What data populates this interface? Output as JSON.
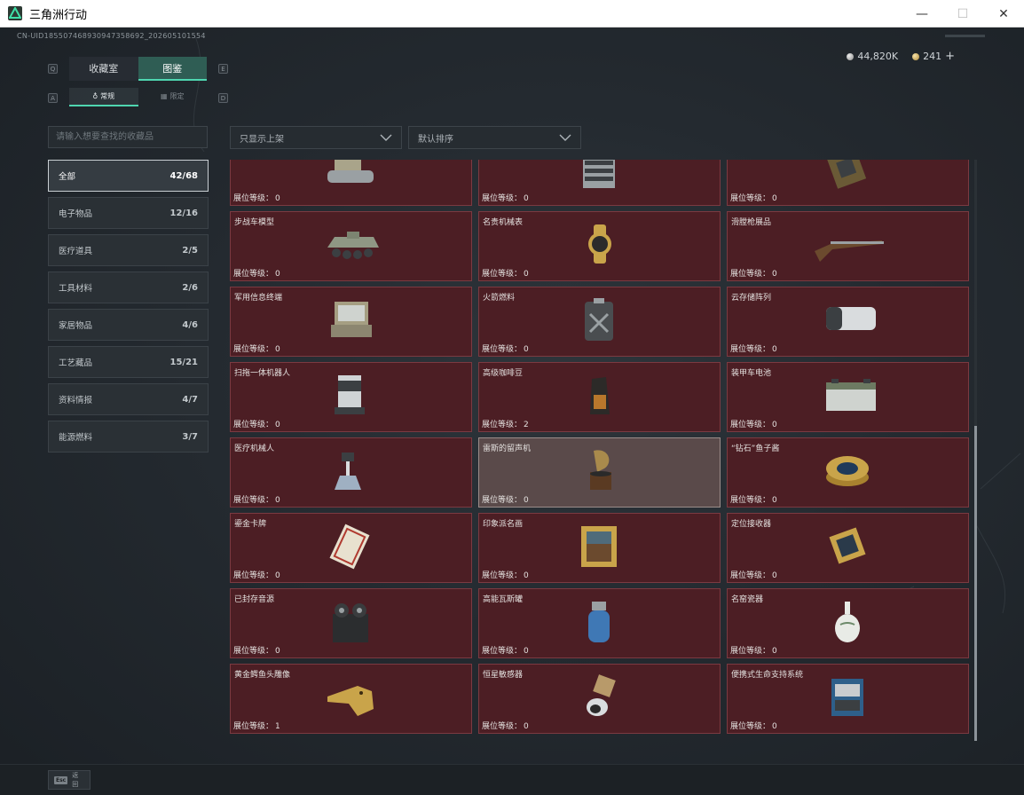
{
  "window": {
    "title": "三角洲行动",
    "min": "—",
    "max": "☐",
    "close": "✕"
  },
  "uid": "CN-UID1855074689309473586​92_202605101554",
  "currency": [
    {
      "value": "44,820K",
      "icon": "silver-coin-icon"
    },
    {
      "value": "241",
      "icon": "gold-coin-icon"
    }
  ],
  "currency_plus": "+",
  "tabs": [
    {
      "label": "收藏室",
      "active": false
    },
    {
      "label": "图鉴",
      "active": true
    }
  ],
  "tab_keys": {
    "left": "Q",
    "right": "E"
  },
  "subtabs": [
    {
      "label": "常规",
      "active": true
    },
    {
      "label": "限定",
      "active": false
    }
  ],
  "subtab_keys": {
    "left": "A",
    "right": "D"
  },
  "search": {
    "placeholder": "请输入想要查找的收藏品"
  },
  "filter": {
    "value": "只显示上架"
  },
  "sort": {
    "value": "默认排序"
  },
  "categories": [
    {
      "name": "全部",
      "count": "42/68",
      "active": true
    },
    {
      "name": "电子物品",
      "count": "12/16"
    },
    {
      "name": "医疗道具",
      "count": "2/5"
    },
    {
      "name": "工具材料",
      "count": "2/6"
    },
    {
      "name": "家居物品",
      "count": "4/6"
    },
    {
      "name": "工艺藏品",
      "count": "15/21"
    },
    {
      "name": "资料情报",
      "count": "4/7"
    },
    {
      "name": "能源燃料",
      "count": "3/7"
    }
  ],
  "level_label": "展位等级：",
  "items": [
    {
      "name": "",
      "level": "0",
      "icon": "tank-icon"
    },
    {
      "name": "",
      "level": "0",
      "icon": "server-rack-icon"
    },
    {
      "name": "",
      "level": "0",
      "icon": "circuit-board-icon"
    },
    {
      "name": "步战车模型",
      "level": "0",
      "icon": "ifv-model-icon"
    },
    {
      "name": "名贵机械表",
      "level": "0",
      "icon": "watch-icon"
    },
    {
      "name": "滑膛枪展品",
      "level": "0",
      "icon": "musket-icon"
    },
    {
      "name": "军用信息终端",
      "level": "0",
      "icon": "military-terminal-icon"
    },
    {
      "name": "火箭燃料",
      "level": "0",
      "icon": "fuel-canister-icon"
    },
    {
      "name": "云存储阵列",
      "level": "0",
      "icon": "storage-array-icon"
    },
    {
      "name": "扫拖一体机器人",
      "level": "0",
      "icon": "cleaning-robot-icon"
    },
    {
      "name": "高级咖啡豆",
      "level": "2",
      "icon": "coffee-bag-icon"
    },
    {
      "name": "装甲车电池",
      "level": "0",
      "icon": "battery-icon"
    },
    {
      "name": "医疗机械人",
      "level": "0",
      "icon": "medical-robot-icon"
    },
    {
      "name": "雷斯的留声机",
      "level": "0",
      "icon": "gramophone-icon",
      "hover": true
    },
    {
      "name": "“钻石”鱼子酱",
      "level": "0",
      "icon": "caviar-tin-icon"
    },
    {
      "name": "鎏金卡牌",
      "level": "0",
      "icon": "gold-card-icon"
    },
    {
      "name": "印象派名画",
      "level": "0",
      "icon": "painting-icon"
    },
    {
      "name": "定位接收器",
      "level": "0",
      "icon": "gps-receiver-icon"
    },
    {
      "name": "已封存音源",
      "level": "0",
      "icon": "tape-recorder-icon"
    },
    {
      "name": "高能瓦斯罐",
      "level": "0",
      "icon": "gas-tank-icon"
    },
    {
      "name": "名窑瓷器",
      "level": "0",
      "icon": "porcelain-vase-icon"
    },
    {
      "name": "黄金鳄鱼头雕像",
      "level": "1",
      "icon": "gold-crocodile-icon"
    },
    {
      "name": "恒星敏感器",
      "level": "0",
      "icon": "star-sensor-icon"
    },
    {
      "name": "便携式生命支持系统",
      "level": "0",
      "icon": "life-support-icon"
    }
  ],
  "bottom": {
    "esc_key": "Esc",
    "esc_label": "返回"
  },
  "colors": {
    "accent": "#4fd6b0",
    "card": "#4c1e24",
    "card_border": "#7b3a41"
  }
}
